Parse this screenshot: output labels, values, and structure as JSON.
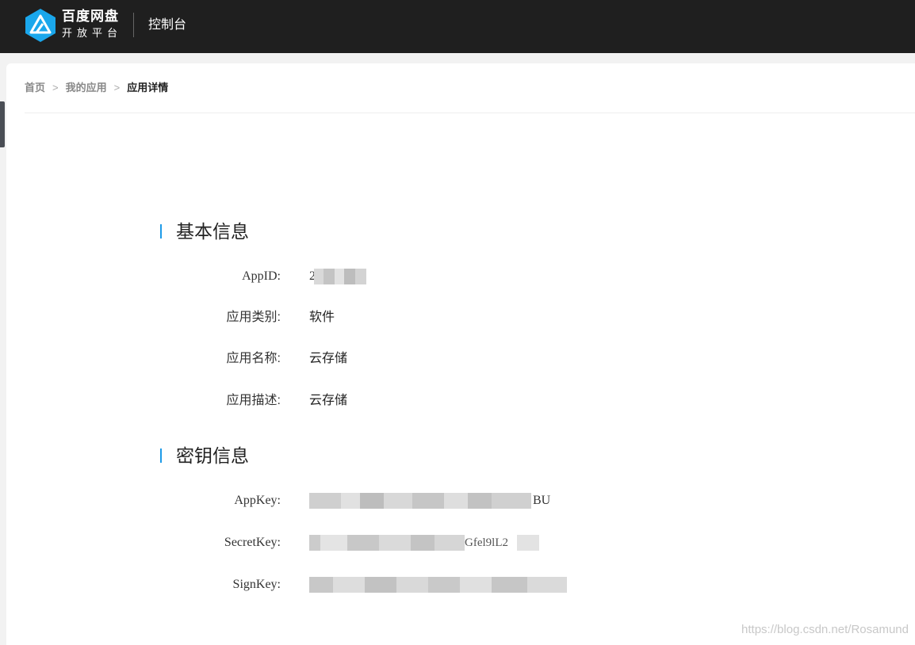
{
  "header": {
    "brand_name": "百度网盘",
    "brand_sub": "开放平台",
    "console": "控制台"
  },
  "breadcrumb": {
    "home": "首页",
    "sep": ">",
    "my_apps": "我的应用",
    "current": "应用详情"
  },
  "basic_info": {
    "title": "基本信息",
    "appid_label": "AppID:",
    "appid_value": "2",
    "category_label": "应用类别:",
    "category_value": "软件",
    "name_label": "应用名称:",
    "name_value": "云存储",
    "desc_label": "应用描述:",
    "desc_value": "云存储"
  },
  "key_info": {
    "title": "密钥信息",
    "appkey_label": "AppKey:",
    "appkey_tail": "BU",
    "secretkey_label": "SecretKey:",
    "secretkey_tail": "Gfel9lL2",
    "signkey_label": "SignKey:"
  },
  "watermark": "https://blog.csdn.net/Rosamund",
  "colors": {
    "topbar": "#1f1f1f",
    "accent": "#1e9be8",
    "logo": "#1aa7ec"
  }
}
